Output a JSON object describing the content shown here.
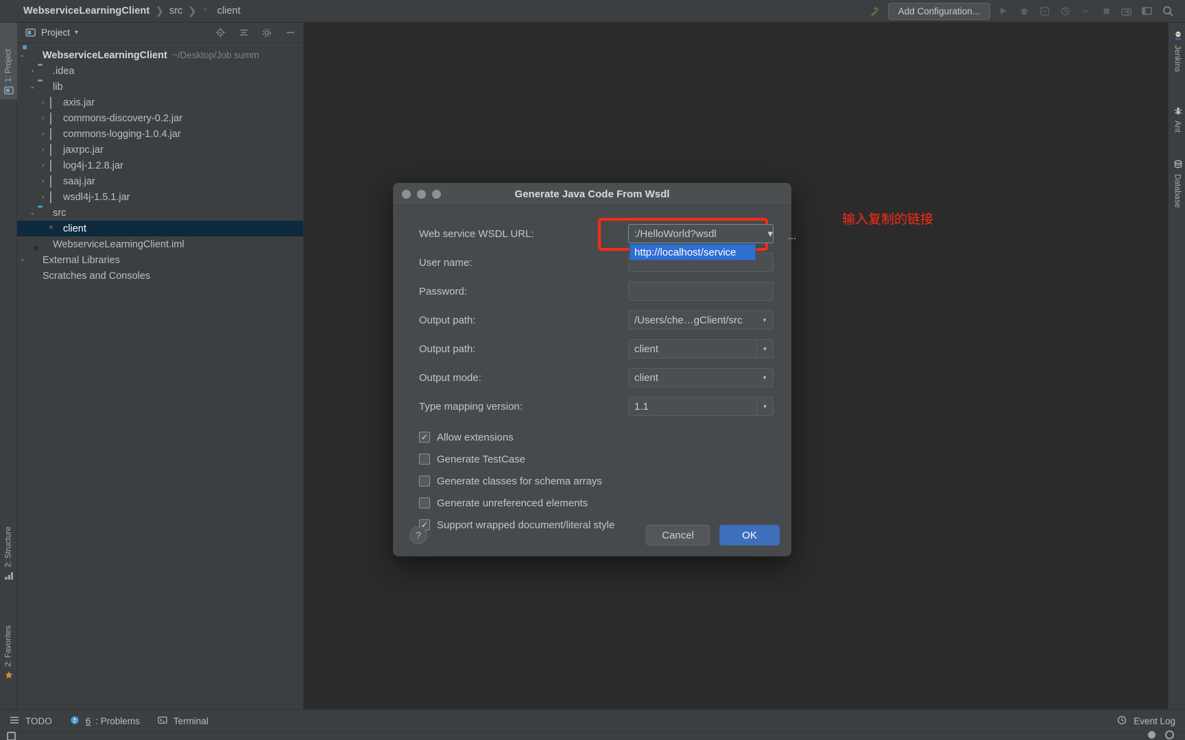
{
  "topbar": {
    "breadcrumb": [
      "WebserviceLearningClient",
      "src",
      "client"
    ],
    "separator": "❯",
    "add_configuration": "Add Configuration...",
    "icons": [
      "hammer-icon",
      "run-icon",
      "debug-icon",
      "run-coverage-icon",
      "profiler-icon",
      "chevron-down-icon",
      "stop-icon",
      "git-update-icon",
      "layout-icon",
      "search-icon"
    ]
  },
  "left_strip": {
    "tabs": [
      {
        "label": "1: Project",
        "icon": "project-icon",
        "active": true
      },
      {
        "label": "2: Structure",
        "icon": "structure-icon",
        "active": false
      },
      {
        "label": "2: Favorites",
        "icon": "favorites-star-icon",
        "active": false
      }
    ]
  },
  "right_strip": {
    "tabs": [
      {
        "label": "Jenkins",
        "icon": "jenkins-icon"
      },
      {
        "label": "Ant",
        "icon": "ant-icon"
      },
      {
        "label": "Database",
        "icon": "database-icon"
      }
    ]
  },
  "project_panel": {
    "title": "Project",
    "title_chevron": "▾",
    "actions": [
      "locate-icon",
      "collapse-all-icon",
      "settings-gear-icon",
      "hide-icon"
    ],
    "tree": [
      {
        "depth": 0,
        "arrow": "⌄",
        "icon": "module-icon",
        "label": "WebserviceLearningClient",
        "bold": true,
        "path": "~/Desktop/Job summ",
        "selected": false
      },
      {
        "depth": 1,
        "arrow": "›",
        "icon": "folder-icon",
        "label": ".idea",
        "bold": false,
        "path": "",
        "selected": false
      },
      {
        "depth": 1,
        "arrow": "⌄",
        "icon": "folder-icon",
        "label": "lib",
        "bold": false,
        "path": "",
        "selected": false
      },
      {
        "depth": 2,
        "arrow": "›",
        "icon": "jar-icon",
        "label": "axis.jar",
        "bold": false,
        "path": "",
        "selected": false
      },
      {
        "depth": 2,
        "arrow": "›",
        "icon": "jar-icon",
        "label": "commons-discovery-0.2.jar",
        "bold": false,
        "path": "",
        "selected": false
      },
      {
        "depth": 2,
        "arrow": "›",
        "icon": "jar-icon",
        "label": "commons-logging-1.0.4.jar",
        "bold": false,
        "path": "",
        "selected": false
      },
      {
        "depth": 2,
        "arrow": "›",
        "icon": "jar-icon",
        "label": "jaxrpc.jar",
        "bold": false,
        "path": "",
        "selected": false
      },
      {
        "depth": 2,
        "arrow": "›",
        "icon": "jar-icon",
        "label": "log4j-1.2.8.jar",
        "bold": false,
        "path": "",
        "selected": false
      },
      {
        "depth": 2,
        "arrow": "›",
        "icon": "jar-icon",
        "label": "saaj.jar",
        "bold": false,
        "path": "",
        "selected": false
      },
      {
        "depth": 2,
        "arrow": "›",
        "icon": "jar-icon",
        "label": "wsdl4j-1.5.1.jar",
        "bold": false,
        "path": "",
        "selected": false
      },
      {
        "depth": 1,
        "arrow": "⌄",
        "icon": "source-folder-icon",
        "label": "src",
        "bold": false,
        "path": "",
        "selected": false
      },
      {
        "depth": 2,
        "arrow": "",
        "icon": "package-folder-icon",
        "label": "client",
        "bold": false,
        "path": "",
        "selected": true
      },
      {
        "depth": 1,
        "arrow": "",
        "icon": "iml-file-icon",
        "label": "WebserviceLearningClient.iml",
        "bold": false,
        "path": "",
        "selected": false
      },
      {
        "depth": 0,
        "arrow": "›",
        "icon": "external-libraries-icon",
        "label": "External Libraries",
        "bold": false,
        "path": "",
        "selected": false
      },
      {
        "depth": 0,
        "arrow": "",
        "icon": "scratches-icon",
        "label": "Scratches and Consoles",
        "bold": false,
        "path": "",
        "selected": false
      }
    ]
  },
  "dialog": {
    "title": "Generate Java Code From Wsdl",
    "traffic_lights": [
      "close-button",
      "minimize-button",
      "zoom-button"
    ],
    "annotation_cn": "输入复制的链接",
    "annotation_color": "#ff2a14",
    "fields": [
      {
        "label": "Web service WSDL URL:",
        "value": ":/HelloWorld?wsdl",
        "type": "combo",
        "focused": true
      },
      {
        "label": "User name:",
        "value": "",
        "type": "text",
        "focused": false
      },
      {
        "label": "Password:",
        "value": "",
        "type": "text",
        "focused": false
      },
      {
        "label": "Output path:",
        "value": "/Users/che…gClient/src",
        "type": "combo",
        "focused": false
      },
      {
        "label": "Output path:",
        "value": "client",
        "type": "combo-framed",
        "focused": false
      },
      {
        "label": "Output mode:",
        "value": "client",
        "type": "combo",
        "focused": false
      },
      {
        "label": "Type mapping version:",
        "value": "1.1",
        "type": "combo",
        "focused": false
      }
    ],
    "autocomplete": {
      "text": "http://localhost/service",
      "selected": true
    },
    "ellipsis_button": "...",
    "dropdown_arrow": "▾",
    "checkboxes": [
      {
        "label": "Allow extensions",
        "checked": true
      },
      {
        "label": "Generate TestCase",
        "checked": false
      },
      {
        "label": "Generate classes for schema arrays",
        "checked": false
      },
      {
        "label": "Generate unreferenced elements",
        "checked": false
      },
      {
        "label": "Support wrapped document/literal style",
        "checked": true
      }
    ],
    "check_glyph": "✓",
    "help_label": "?",
    "cancel_label": "Cancel",
    "ok_label": "OK",
    "ok_color": "#3d6fba"
  },
  "bottombar": {
    "items": [
      {
        "label": "TODO",
        "icon": "todo-icon",
        "num": ""
      },
      {
        "label": ": Problems",
        "icon": "problems-icon",
        "num": "6"
      },
      {
        "label": "Terminal",
        "icon": "terminal-icon",
        "num": ""
      }
    ],
    "event_log": "Event Log",
    "event_log_icon": "event-log-icon"
  }
}
